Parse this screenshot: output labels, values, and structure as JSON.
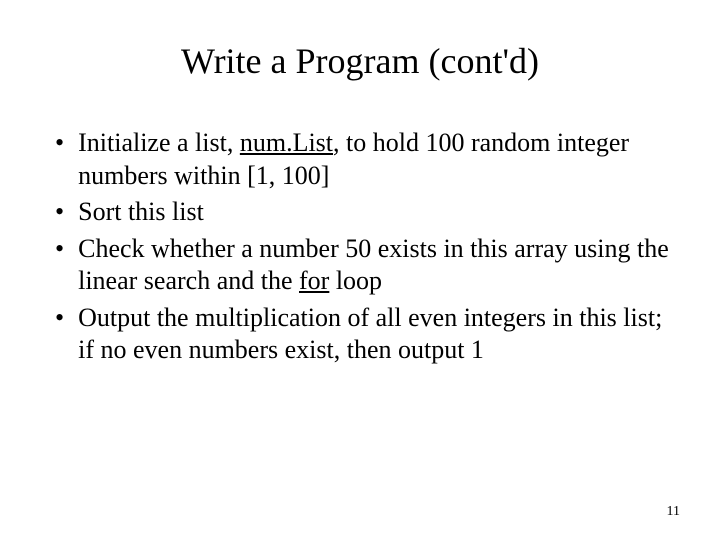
{
  "title": "Write a Program (cont'd)",
  "bullets": [
    {
      "parts": [
        {
          "text": "Initialize a list, ",
          "underline": false
        },
        {
          "text": "num.List",
          "underline": true
        },
        {
          "text": ", to hold 100 random integer numbers within [1, 100]",
          "underline": false
        }
      ]
    },
    {
      "parts": [
        {
          "text": "Sort this list",
          "underline": false
        }
      ]
    },
    {
      "parts": [
        {
          "text": "Check whether a number 50 exists in this array using the linear search and the ",
          "underline": false
        },
        {
          "text": "for",
          "underline": true
        },
        {
          "text": " loop",
          "underline": false
        }
      ]
    },
    {
      "parts": [
        {
          "text": "Output the multiplication of all even integers in this list; if no even numbers exist, then output 1",
          "underline": false
        }
      ]
    }
  ],
  "pageNumber": "11"
}
